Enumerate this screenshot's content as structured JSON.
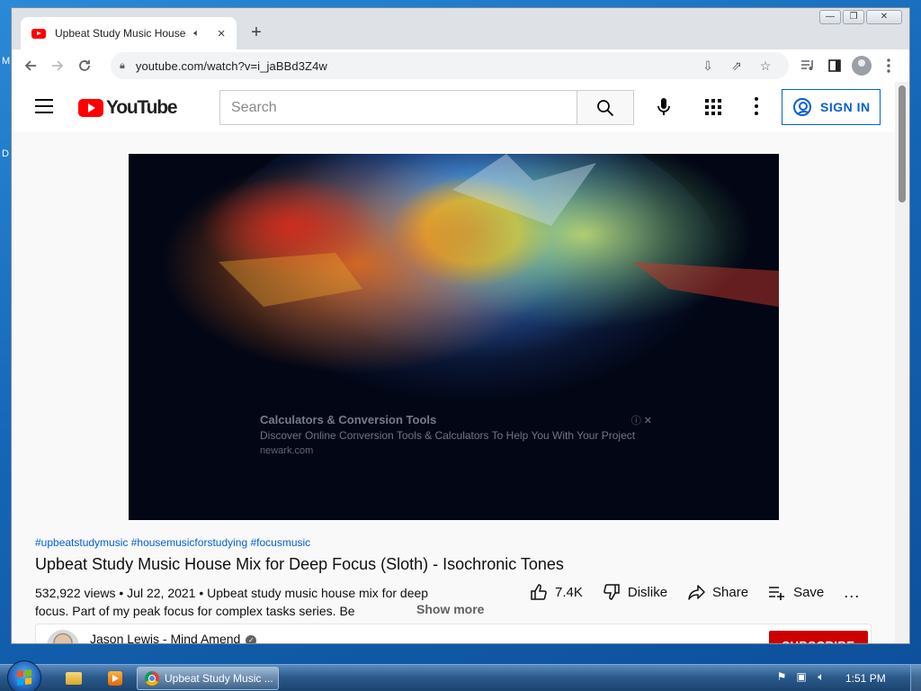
{
  "desktop": {
    "edge_text_top": "M",
    "edge_text_mid": "D"
  },
  "browser": {
    "tab_title": "Upbeat Study Music House Mix for Deep Focus",
    "tab_audio_icon": "speaker-icon",
    "tab_close": "×",
    "new_tab": "+",
    "url": "youtube.com/watch?v=i_jaBBd3Z4w",
    "window_controls": {
      "minimize": "—",
      "restore": "❐",
      "close": "✕"
    }
  },
  "youtube": {
    "logo_text": "YouTube",
    "search_placeholder": "Search",
    "sign_in": "SIGN IN",
    "ad": {
      "title": "Calculators & Conversion Tools",
      "description": "Discover Online Conversion Tools & Calculators To Help You With Your Project",
      "domain": "newark.com",
      "info": "ⓘ ✕"
    },
    "hashtags": "#upbeatstudymusic #housemusicforstudying #focusmusic",
    "video_title": "Upbeat Study Music House Mix for Deep Focus (Sloth) - Isochronic Tones",
    "description": "532,922 views • Jul 22, 2021 • Upbeat study music house mix for deep focus.  Part of my peak focus for complex tasks series.  Be",
    "show_more": "Show more",
    "actions": {
      "likes": "7.4K",
      "dislike": "Dislike",
      "share": "Share",
      "save": "Save",
      "more": "..."
    },
    "channel": {
      "name": "Jason Lewis - Mind Amend",
      "subscribe": "SUBSCRIBE"
    }
  },
  "taskbar": {
    "task_label": "Upbeat Study Music ...",
    "clock": "1:51 PM"
  },
  "colors": {
    "youtube_red": "#ff0000",
    "link_blue": "#065fd4",
    "subscribe_red": "#cc0000"
  }
}
